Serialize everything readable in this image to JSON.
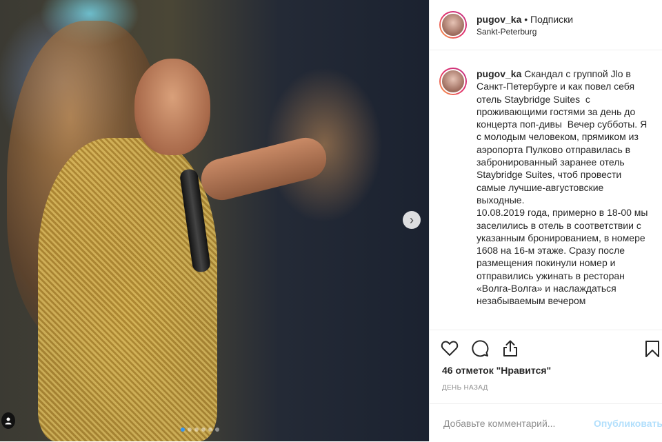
{
  "post": {
    "username": "pugov_ka",
    "separator": "•",
    "follow_label": "Подписки",
    "location": "Sankt-Peterburg"
  },
  "caption": {
    "username": "pugov_ka",
    "text": " Скандал с группой Jlo в Санкт-Петербурге и как повел себя отель Staybridge Suites  с проживающими гостями за день до концерта поп-дивы  Вечер субботы. Я с молодым человеком, прямиком из аэропорта Пулково отправилась в забронированный заранее отель Staybridge Suites, чтоб провести самые лучшие-августовские выходные.\n10.08.2019 года, примерно в 18-00 мы заселились в отель в соответствии с указанным бронированием, в номере 1608 на 16-м этаже. Сразу после размещения покинули номер и отправились ужинать в ресторан «Волга-Волга» и наслаждаться незабываемым вечером"
  },
  "actions": {
    "icons": [
      "heart-icon",
      "comment-icon",
      "share-icon",
      "bookmark-icon"
    ]
  },
  "likes_text": "46 отметок \"Нравится\"",
  "timestamp": "день назад",
  "comment": {
    "placeholder": "Добавьте комментарий...",
    "publish_label": "Опубликовать"
  },
  "carousel": {
    "next_icon": "chevron-right-icon",
    "total": 6,
    "current": 1
  },
  "colors": {
    "accent": "#3897f0",
    "publish_disabled": "#b2dffc",
    "text": "#262626",
    "muted": "#8e8e8e"
  }
}
